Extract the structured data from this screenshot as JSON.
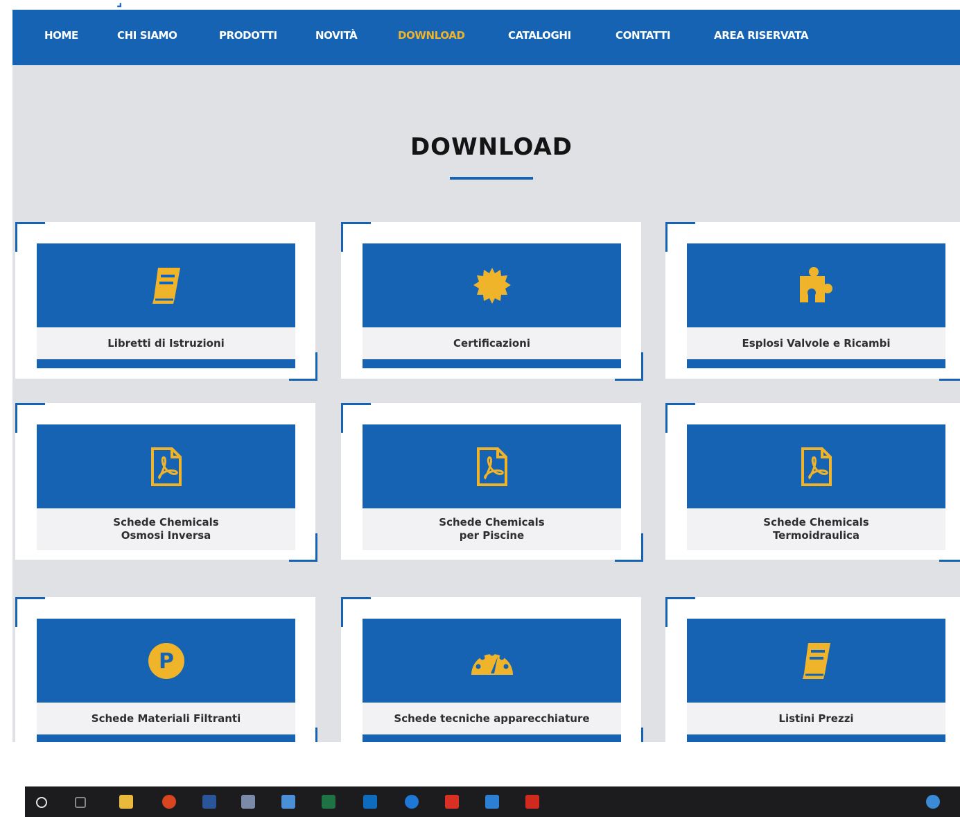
{
  "nav": {
    "items": [
      {
        "label": "HOME",
        "active": false
      },
      {
        "label": "CHI SIAMO",
        "active": false
      },
      {
        "label": "PRODOTTI",
        "active": false
      },
      {
        "label": "NOVITÀ",
        "active": false
      },
      {
        "label": "DOWNLOAD",
        "active": true
      },
      {
        "label": "CATALOGHI",
        "active": false
      },
      {
        "label": "CONTATTI",
        "active": false
      },
      {
        "label": "AREA RISERVATA",
        "active": false
      }
    ]
  },
  "page": {
    "title": "DOWNLOAD"
  },
  "cards": [
    {
      "label": "Libretti di Istruzioni",
      "icon": "book-icon"
    },
    {
      "label": "Certificazioni",
      "icon": "certificate-badge-icon"
    },
    {
      "label": "Esplosi Valvole e Ricambi",
      "icon": "puzzle-piece-icon"
    },
    {
      "label": "Schede Chemicals\nOsmosi Inversa",
      "icon": "pdf-file-icon"
    },
    {
      "label": "Schede Chemicals\nper Piscine",
      "icon": "pdf-file-icon"
    },
    {
      "label": "Schede Chemicals\nTermoidraulica",
      "icon": "pdf-file-icon"
    },
    {
      "label": "Schede Materiali Filtranti",
      "icon": "p-circle-icon"
    },
    {
      "label": "Schede tecniche apparecchiature",
      "icon": "gauge-icon"
    },
    {
      "label": "Listini Prezzi",
      "icon": "book-icon"
    }
  ],
  "colors": {
    "primary": "#1563b2",
    "accent": "#f0b42a",
    "background": "#e0e1e5",
    "label_background": "#f2f2f4"
  },
  "taskbar": {
    "icons": [
      "search-circle-icon",
      "task-view-icon",
      "file-explorer-icon",
      "chrome-icon",
      "word-icon",
      "paint-icon",
      "scanner-icon",
      "excel-icon",
      "outlook-icon",
      "teamviewer-icon",
      "recorder-icon",
      "photos-icon",
      "acrobat-icon",
      "help-icon"
    ]
  }
}
